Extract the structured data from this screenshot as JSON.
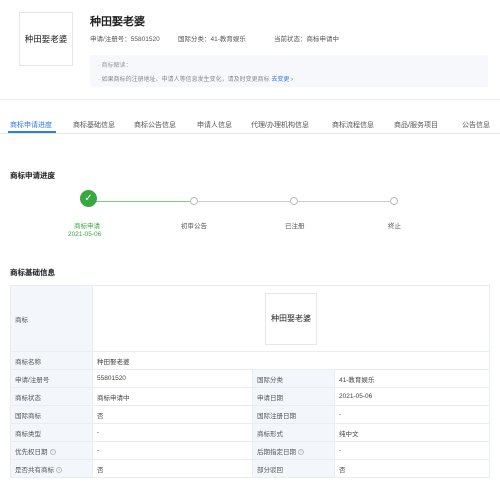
{
  "header": {
    "logo_text": "种田娶老婆",
    "title": "种田娶老婆",
    "reg_no": "申请/注册号：55801520",
    "intl_class": "国际分类：41-教育娱乐",
    "status": "当前状态：商标申请中"
  },
  "notice": {
    "label": "· 商标解读：",
    "text": "· 如果商标的注册地址、申请人等信息发生变化，请及时变更商标",
    "link": "去变更 ›"
  },
  "tabs": [
    "商标申请进度",
    "商标基础信息",
    "商标公告信息",
    "申请人信息",
    "代理/办理机构信息",
    "商标流程信息",
    "商品/服务项目",
    "公告信息"
  ],
  "progress": {
    "title": "商标申请进度",
    "steps": [
      {
        "label": "商标申请",
        "date": "2021-05-06"
      },
      {
        "label": "初审公告"
      },
      {
        "label": "已注册"
      },
      {
        "label": "终止"
      }
    ]
  },
  "basic": {
    "title": "商标基础信息",
    "rows": {
      "image_label": "商标",
      "image_text": "种田娶老婆",
      "name_label": "商标名称",
      "name_value": "种田娶老婆",
      "regno_label": "申请/注册号",
      "regno_value": "55801520",
      "class_label": "国际分类",
      "class_value": "41-教育娱乐",
      "status_label": "商标状态",
      "status_value": "商标申请中",
      "apply_date_label": "申请日期",
      "apply_date_value": "2021-05-06",
      "intl_mark_label": "国际商标",
      "intl_mark_value": "否",
      "intl_reg_date_label": "国际注册日期",
      "intl_reg_date_value": "-",
      "type_label": "商标类型",
      "type_value": "-",
      "form_label": "商标形式",
      "form_value": "纯中文",
      "priority_label": "优先权日期",
      "priority_value": "-",
      "later_date_label": "后期指定日期",
      "later_date_value": "-",
      "shared_label": "是否共有商标",
      "shared_value": "否",
      "partial_label": "部分驳回",
      "partial_value": "否"
    }
  }
}
